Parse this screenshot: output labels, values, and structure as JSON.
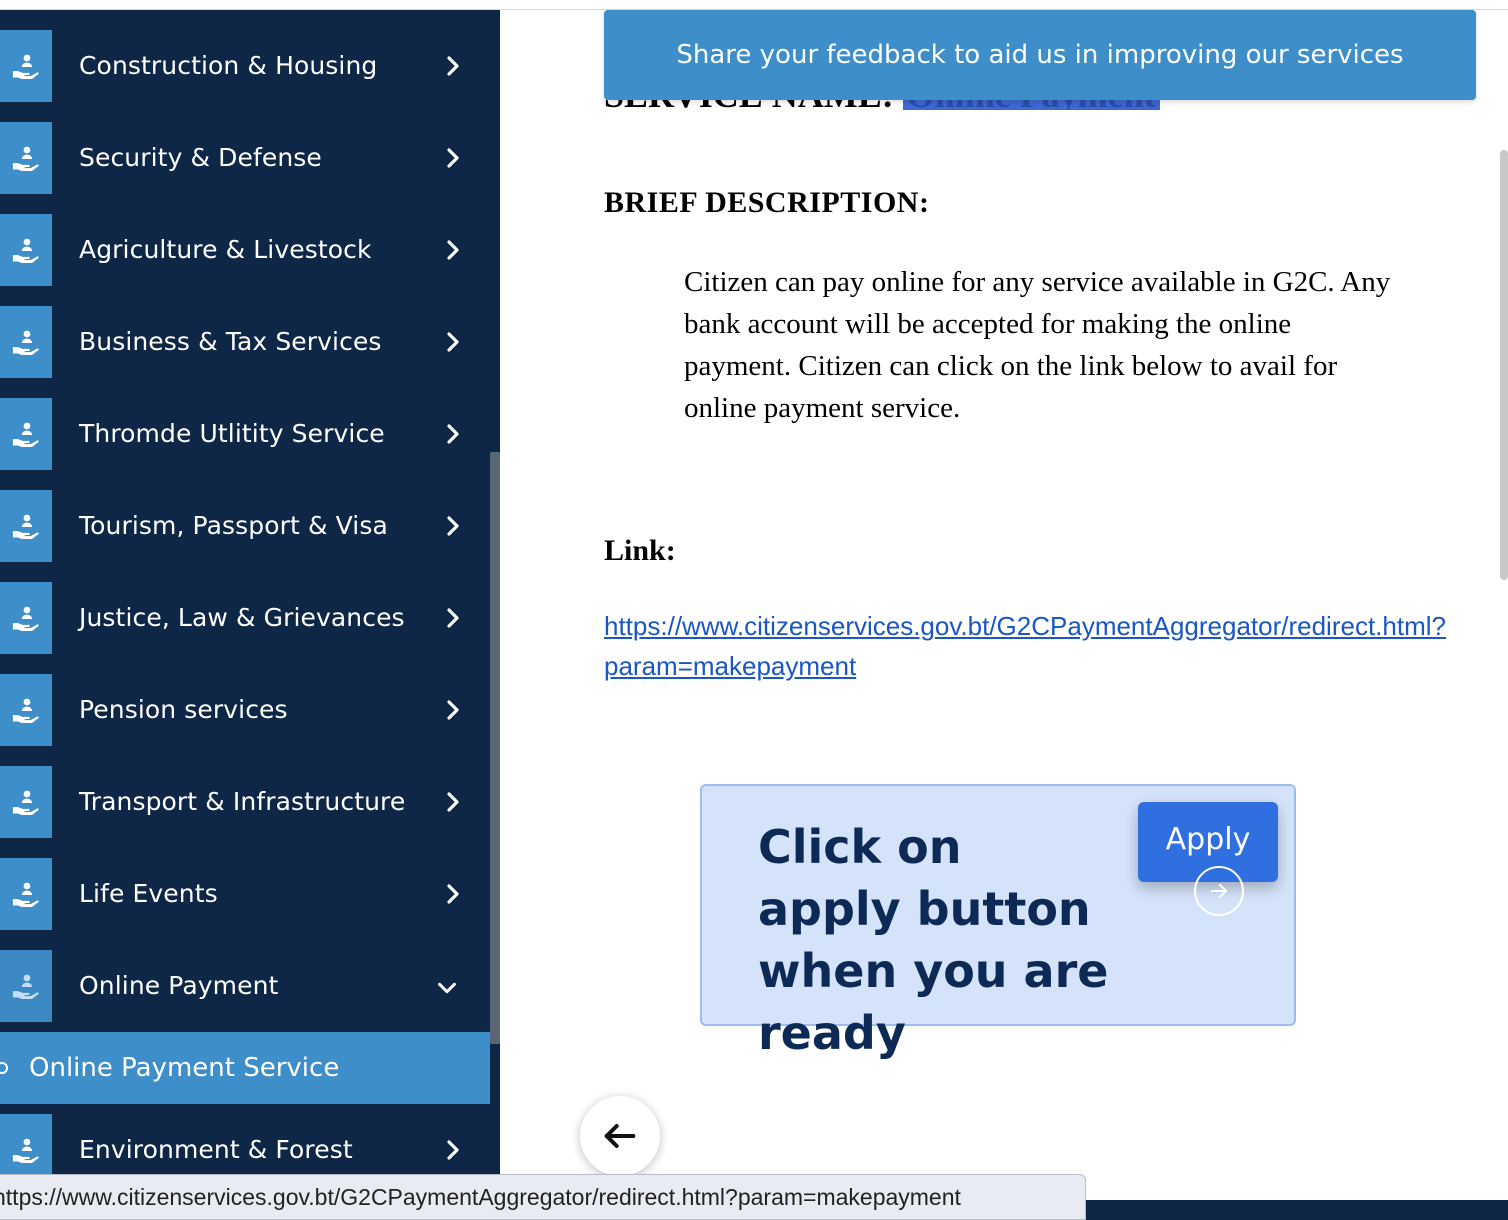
{
  "sidebar": {
    "items": [
      {
        "label": "Construction & Housing",
        "state": "collapsed"
      },
      {
        "label": "Security & Defense",
        "state": "collapsed"
      },
      {
        "label": "Agriculture & Livestock",
        "state": "collapsed"
      },
      {
        "label": "Business & Tax Services",
        "state": "collapsed"
      },
      {
        "label": "Thromde Utlitity Service",
        "state": "collapsed"
      },
      {
        "label": "Tourism, Passport & Visa",
        "state": "collapsed"
      },
      {
        "label": "Justice, Law & Grievances",
        "state": "collapsed"
      },
      {
        "label": "Pension services",
        "state": "collapsed"
      },
      {
        "label": "Transport & Infrastructure",
        "state": "collapsed"
      },
      {
        "label": "Life Events",
        "state": "collapsed"
      },
      {
        "label": "Online Payment",
        "state": "expanded"
      },
      {
        "label": "Environment & Forest",
        "state": "collapsed"
      }
    ],
    "active_sub_item": {
      "label": "Online Payment Service"
    },
    "icon": "hand-with-person-icon"
  },
  "main": {
    "feedback_banner": "Share your feedback to aid us in improving our services",
    "service_name_prefix": "SERVICE NAME:",
    "service_name_value": "Online Payment",
    "brief_heading": "BRIEF DESCRIPTION:",
    "brief_body": "Citizen can pay online for any service available in G2C. Any bank account will be accepted for making the online payment. Citizen can click on the link below to avail for online payment service.",
    "link_heading": "Link:",
    "link_line1": "https://www.citizenservices.gov.bt/G2CPaymentAggregator/redirect.html?",
    "link_line2": "param=makepayment",
    "apply_card": {
      "text": "Click on apply button when you are ready",
      "button_label": "Apply"
    }
  },
  "status_bar": {
    "url": "https://www.citizenservices.gov.bt/G2CPaymentAggregator/redirect.html?param=makepayment"
  },
  "colors": {
    "sidebar_bg": "#0e2747",
    "accent": "#3e8ec9",
    "apply_button": "#2f6fe0",
    "card_bg": "#d4e2fa",
    "link": "#1a56c4"
  }
}
